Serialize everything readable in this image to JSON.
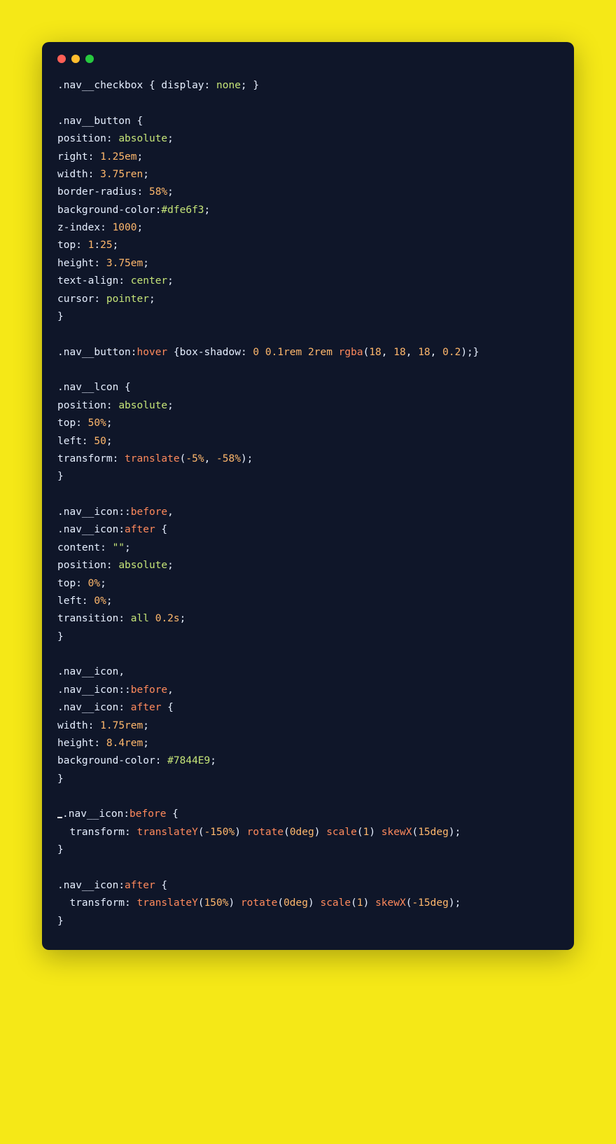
{
  "colors": {
    "page_bg": "#f5e817",
    "window_bg": "#0f1629",
    "dot_red": "#ff5f56",
    "dot_yellow": "#ffbd2e",
    "dot_green": "#27c93f",
    "text_default": "#e6efff",
    "text_value": "#c5e478",
    "text_number": "#ffb86c",
    "text_pseudo": "#ff8a5c"
  },
  "code_tokens": [
    [
      [
        "sel",
        ".nav__checkbox"
      ],
      [
        "punct",
        " { "
      ],
      [
        "prop",
        "display"
      ],
      [
        "punct",
        ": "
      ],
      [
        "val",
        "none"
      ],
      [
        "punct",
        "; }"
      ]
    ],
    [],
    [
      [
        "sel",
        ".nav__button"
      ],
      [
        "punct",
        " {"
      ]
    ],
    [
      [
        "prop",
        "position"
      ],
      [
        "punct",
        ": "
      ],
      [
        "val",
        "absolute"
      ],
      [
        "punct",
        ";"
      ]
    ],
    [
      [
        "prop",
        "right"
      ],
      [
        "punct",
        ": "
      ],
      [
        "num",
        "1.25em"
      ],
      [
        "punct",
        ";"
      ]
    ],
    [
      [
        "prop",
        "width"
      ],
      [
        "punct",
        ": "
      ],
      [
        "num",
        "3.75ren"
      ],
      [
        "punct",
        ";"
      ]
    ],
    [
      [
        "prop",
        "border-radius"
      ],
      [
        "punct",
        ": "
      ],
      [
        "num",
        "58%"
      ],
      [
        "punct",
        ";"
      ]
    ],
    [
      [
        "prop",
        "background-color"
      ],
      [
        "punct",
        ":"
      ],
      [
        "hex",
        "#dfe6f3"
      ],
      [
        "punct",
        ";"
      ]
    ],
    [
      [
        "prop",
        "z-index"
      ],
      [
        "punct",
        ": "
      ],
      [
        "num",
        "1000"
      ],
      [
        "punct",
        ";"
      ]
    ],
    [
      [
        "prop",
        "top"
      ],
      [
        "punct",
        ": "
      ],
      [
        "num",
        "1"
      ],
      [
        "punct",
        ":"
      ],
      [
        "num",
        "25"
      ],
      [
        "punct",
        ";"
      ]
    ],
    [
      [
        "prop",
        "height"
      ],
      [
        "punct",
        ": "
      ],
      [
        "num",
        "3.75em"
      ],
      [
        "punct",
        ";"
      ]
    ],
    [
      [
        "prop",
        "text-align"
      ],
      [
        "punct",
        ": "
      ],
      [
        "val",
        "center"
      ],
      [
        "punct",
        ";"
      ]
    ],
    [
      [
        "prop",
        "cursor"
      ],
      [
        "punct",
        ": "
      ],
      [
        "val",
        "pointer"
      ],
      [
        "punct",
        ";"
      ]
    ],
    [
      [
        "punct",
        "}"
      ]
    ],
    [],
    [
      [
        "sel",
        ".nav__button"
      ],
      [
        "punct",
        ":"
      ],
      [
        "psd",
        "hover"
      ],
      [
        "punct",
        " {"
      ],
      [
        "prop",
        "box-shadow"
      ],
      [
        "punct",
        ": "
      ],
      [
        "num",
        "0"
      ],
      [
        "punct",
        " "
      ],
      [
        "num",
        "0.1rem"
      ],
      [
        "punct",
        " "
      ],
      [
        "num",
        "2rem"
      ],
      [
        "punct",
        " "
      ],
      [
        "func",
        "rgba"
      ],
      [
        "punct",
        "("
      ],
      [
        "num",
        "18"
      ],
      [
        "punct",
        ", "
      ],
      [
        "num",
        "18"
      ],
      [
        "punct",
        ", "
      ],
      [
        "num",
        "18"
      ],
      [
        "punct",
        ", "
      ],
      [
        "num",
        "0.2"
      ],
      [
        "punct",
        ");}"
      ]
    ],
    [],
    [
      [
        "sel",
        ".nav__lcon"
      ],
      [
        "punct",
        " {"
      ]
    ],
    [
      [
        "prop",
        "position"
      ],
      [
        "punct",
        ": "
      ],
      [
        "val",
        "absolute"
      ],
      [
        "punct",
        ";"
      ]
    ],
    [
      [
        "prop",
        "top"
      ],
      [
        "punct",
        ": "
      ],
      [
        "num",
        "50%"
      ],
      [
        "punct",
        ";"
      ]
    ],
    [
      [
        "prop",
        "left"
      ],
      [
        "punct",
        ": "
      ],
      [
        "num",
        "50"
      ],
      [
        "punct",
        ";"
      ]
    ],
    [
      [
        "prop",
        "transform"
      ],
      [
        "punct",
        ": "
      ],
      [
        "func",
        "translate"
      ],
      [
        "punct",
        "("
      ],
      [
        "num",
        "-5%"
      ],
      [
        "punct",
        ", "
      ],
      [
        "num",
        "-58%"
      ],
      [
        "punct",
        ");"
      ]
    ],
    [
      [
        "punct",
        "}"
      ]
    ],
    [],
    [
      [
        "sel",
        ".nav__icon"
      ],
      [
        "punct",
        "::"
      ],
      [
        "psd",
        "before"
      ],
      [
        "punct",
        ","
      ]
    ],
    [
      [
        "sel",
        ".nav__icon"
      ],
      [
        "punct",
        ":"
      ],
      [
        "psd",
        "after"
      ],
      [
        "punct",
        " {"
      ]
    ],
    [
      [
        "prop",
        "content"
      ],
      [
        "punct",
        ": "
      ],
      [
        "str",
        "\"\""
      ],
      [
        "punct",
        ";"
      ]
    ],
    [
      [
        "prop",
        "position"
      ],
      [
        "punct",
        ": "
      ],
      [
        "val",
        "absolute"
      ],
      [
        "punct",
        ";"
      ]
    ],
    [
      [
        "prop",
        "top"
      ],
      [
        "punct",
        ": "
      ],
      [
        "num",
        "0%"
      ],
      [
        "punct",
        ";"
      ]
    ],
    [
      [
        "prop",
        "left"
      ],
      [
        "punct",
        ": "
      ],
      [
        "num",
        "0%"
      ],
      [
        "punct",
        ";"
      ]
    ],
    [
      [
        "prop",
        "transition"
      ],
      [
        "punct",
        ": "
      ],
      [
        "val",
        "all"
      ],
      [
        "punct",
        " "
      ],
      [
        "num",
        "0.2s"
      ],
      [
        "punct",
        ";"
      ]
    ],
    [
      [
        "punct",
        "}"
      ]
    ],
    [],
    [
      [
        "sel",
        ".nav__icon"
      ],
      [
        "punct",
        ","
      ]
    ],
    [
      [
        "sel",
        ".nav__icon"
      ],
      [
        "punct",
        "::"
      ],
      [
        "psd",
        "before"
      ],
      [
        "punct",
        ","
      ]
    ],
    [
      [
        "sel",
        ".nav__icon"
      ],
      [
        "punct",
        ": "
      ],
      [
        "psd",
        "after"
      ],
      [
        "punct",
        " {"
      ]
    ],
    [
      [
        "prop",
        "width"
      ],
      [
        "punct",
        ": "
      ],
      [
        "num",
        "1.75rem"
      ],
      [
        "punct",
        ";"
      ]
    ],
    [
      [
        "prop",
        "height"
      ],
      [
        "punct",
        ": "
      ],
      [
        "num",
        "8.4rem"
      ],
      [
        "punct",
        ";"
      ]
    ],
    [
      [
        "prop",
        "background-color"
      ],
      [
        "punct",
        ": "
      ],
      [
        "hex",
        "#7844E9"
      ],
      [
        "punct",
        ";"
      ]
    ],
    [
      [
        "punct",
        "}"
      ]
    ],
    [],
    [
      [
        "cursor",
        ""
      ],
      [
        "sel",
        ".nav__icon"
      ],
      [
        "punct",
        ":"
      ],
      [
        "psd",
        "before"
      ],
      [
        "punct",
        " {"
      ]
    ],
    [
      [
        "punct",
        "  "
      ],
      [
        "prop",
        "transform"
      ],
      [
        "punct",
        ": "
      ],
      [
        "func",
        "translateY"
      ],
      [
        "punct",
        "("
      ],
      [
        "num",
        "-150%"
      ],
      [
        "punct",
        ") "
      ],
      [
        "func",
        "rotate"
      ],
      [
        "punct",
        "("
      ],
      [
        "num",
        "0deg"
      ],
      [
        "punct",
        ") "
      ],
      [
        "func",
        "scale"
      ],
      [
        "punct",
        "("
      ],
      [
        "num",
        "1"
      ],
      [
        "punct",
        ") "
      ],
      [
        "func",
        "skewX"
      ],
      [
        "punct",
        "("
      ],
      [
        "num",
        "15deg"
      ],
      [
        "punct",
        ");"
      ]
    ],
    [
      [
        "punct",
        "}"
      ]
    ],
    [],
    [
      [
        "sel",
        ".nav__icon"
      ],
      [
        "punct",
        ":"
      ],
      [
        "psd",
        "after"
      ],
      [
        "punct",
        " {"
      ]
    ],
    [
      [
        "punct",
        "  "
      ],
      [
        "prop",
        "transform"
      ],
      [
        "punct",
        ": "
      ],
      [
        "func",
        "translateY"
      ],
      [
        "punct",
        "("
      ],
      [
        "num",
        "150%"
      ],
      [
        "punct",
        ") "
      ],
      [
        "func",
        "rotate"
      ],
      [
        "punct",
        "("
      ],
      [
        "num",
        "0deg"
      ],
      [
        "punct",
        ") "
      ],
      [
        "func",
        "scale"
      ],
      [
        "punct",
        "("
      ],
      [
        "num",
        "1"
      ],
      [
        "punct",
        ") "
      ],
      [
        "func",
        "skewX"
      ],
      [
        "punct",
        "("
      ],
      [
        "num",
        "-15deg"
      ],
      [
        "punct",
        ");"
      ]
    ],
    [
      [
        "punct",
        "}"
      ]
    ]
  ]
}
